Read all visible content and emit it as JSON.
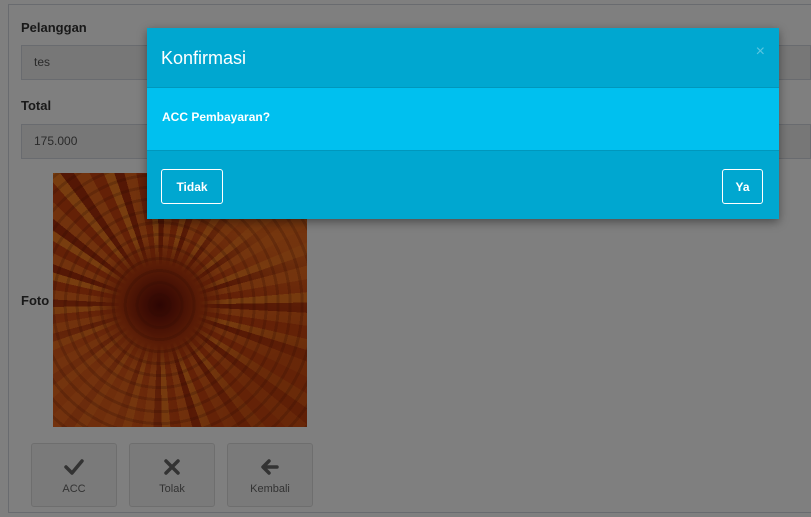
{
  "form": {
    "customer_label": "Pelanggan",
    "customer_value": "tes",
    "total_label": "Total",
    "total_value": "175.000",
    "photo_label": "Foto"
  },
  "actions": [
    {
      "label": "ACC",
      "icon": "check-icon"
    },
    {
      "label": "Tolak",
      "icon": "times-icon"
    },
    {
      "label": "Kembali",
      "icon": "arrow-left-icon"
    }
  ],
  "modal": {
    "title": "Konfirmasi",
    "close_glyph": "×",
    "message": "ACC Pembayaran?",
    "cancel_label": "Tidak",
    "confirm_label": "Ya"
  },
  "colors": {
    "modal_header": "#00a7d0",
    "modal_body": "#00c0ef",
    "overlay": "rgba(0,0,0,0.5)"
  }
}
